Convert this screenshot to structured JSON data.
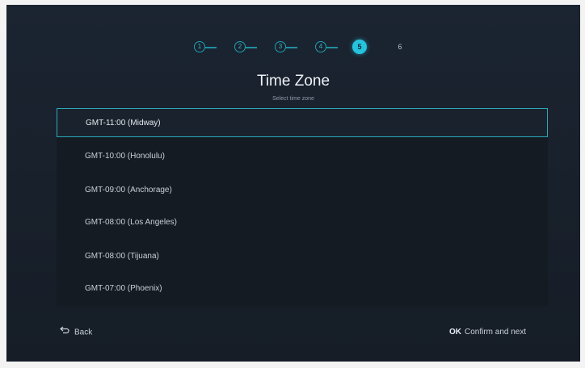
{
  "stepper": {
    "steps": [
      {
        "label": "1",
        "state": "done"
      },
      {
        "label": "2",
        "state": "done"
      },
      {
        "label": "3",
        "state": "done"
      },
      {
        "label": "4",
        "state": "done"
      },
      {
        "label": "5",
        "state": "active"
      },
      {
        "label": "6",
        "state": "upcoming"
      }
    ],
    "current_step": 5
  },
  "header": {
    "title": "Time Zone",
    "subtitle": "Select time zone"
  },
  "timezones": {
    "selected_index": 0,
    "items": [
      "GMT-11:00 (Midway)",
      "GMT-10:00 (Honolulu)",
      "GMT-09:00 (Anchorage)",
      "GMT-08:00 (Los Angeles)",
      "GMT-08:00 (Tijuana)",
      "GMT-07:00 (Phoenix)"
    ]
  },
  "footer": {
    "back_label": "Back",
    "back_icon": "back-arrow-icon",
    "ok_key": "OK",
    "confirm_label": "Confirm and next"
  },
  "colors": {
    "accent": "#26c3dd",
    "background": "#18202b",
    "list_background": "#141b23",
    "selection_border": "#2aa9b9"
  }
}
